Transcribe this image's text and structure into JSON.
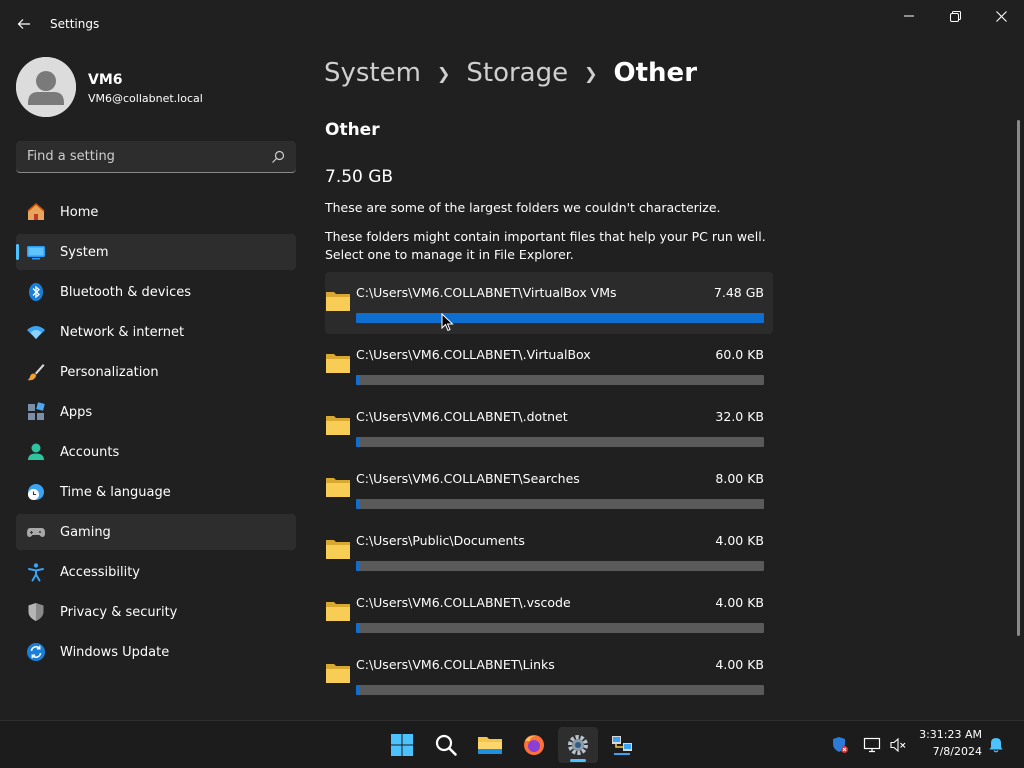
{
  "window": {
    "title": "Settings"
  },
  "profile": {
    "name": "VM6",
    "email": "VM6@collabnet.local"
  },
  "search": {
    "placeholder": "Find a setting"
  },
  "nav": {
    "items": [
      {
        "label": "Home",
        "icon": "home-icon"
      },
      {
        "label": "System",
        "icon": "system-icon"
      },
      {
        "label": "Bluetooth & devices",
        "icon": "bluetooth-icon"
      },
      {
        "label": "Network & internet",
        "icon": "wifi-icon"
      },
      {
        "label": "Personalization",
        "icon": "brush-icon"
      },
      {
        "label": "Apps",
        "icon": "apps-icon"
      },
      {
        "label": "Accounts",
        "icon": "accounts-icon"
      },
      {
        "label": "Time & language",
        "icon": "clock-globe-icon"
      },
      {
        "label": "Gaming",
        "icon": "gamepad-icon"
      },
      {
        "label": "Accessibility",
        "icon": "accessibility-icon"
      },
      {
        "label": "Privacy & security",
        "icon": "shield-icon"
      },
      {
        "label": "Windows Update",
        "icon": "update-icon"
      }
    ],
    "selected": "System",
    "hovered": "Gaming"
  },
  "breadcrumb": {
    "items": [
      "System",
      "Storage",
      "Other"
    ]
  },
  "main": {
    "section_title": "Other",
    "total_size": "7.50 GB",
    "description1": "These are some of the largest folders we couldn't characterize.",
    "description2": "These folders might contain important files that help your PC run well. Select one to manage it in File Explorer.",
    "folders": [
      {
        "path": "C:\\Users\\VM6.COLLABNET\\VirtualBox VMs",
        "size": "7.48 GB",
        "fraction": 1.0
      },
      {
        "path": "C:\\Users\\VM6.COLLABNET\\.VirtualBox",
        "size": "60.0 KB",
        "fraction": 0.01
      },
      {
        "path": "C:\\Users\\VM6.COLLABNET\\.dotnet",
        "size": "32.0 KB",
        "fraction": 0.01
      },
      {
        "path": "C:\\Users\\VM6.COLLABNET\\Searches",
        "size": "8.00 KB",
        "fraction": 0.01
      },
      {
        "path": "C:\\Users\\Public\\Documents",
        "size": "4.00 KB",
        "fraction": 0.01
      },
      {
        "path": "C:\\Users\\VM6.COLLABNET\\.vscode",
        "size": "4.00 KB",
        "fraction": 0.01
      },
      {
        "path": "C:\\Users\\VM6.COLLABNET\\Links",
        "size": "4.00 KB",
        "fraction": 0.01
      }
    ]
  },
  "taskbar": {
    "apps": [
      "start-icon",
      "search-icon",
      "file-explorer-icon",
      "firefox-icon",
      "settings-icon",
      "network-tool-icon"
    ],
    "active_app": "settings-icon",
    "tray": [
      "defender-icon",
      "display-icon",
      "volume-muted-icon",
      "notification-bell-icon"
    ],
    "time": "3:31:23 AM",
    "date": "7/8/2024"
  },
  "colors": {
    "accent": "#4cc2ff",
    "bar_fill": "#0e6fd1",
    "bar_track": "#5a5a5a",
    "background": "#202020",
    "folder": "#f4c54c"
  }
}
